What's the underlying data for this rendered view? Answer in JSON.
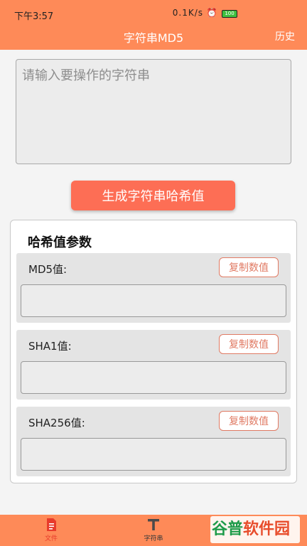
{
  "status_bar": {
    "time": "下午3:57",
    "speed": "0.1K/s",
    "battery": "100"
  },
  "header": {
    "title": "字符串MD5",
    "history_label": "历史"
  },
  "input": {
    "placeholder": "请输入要操作的字符串",
    "value": ""
  },
  "generate_button": "生成字符串哈希值",
  "hash_panel": {
    "title": "哈希值参数",
    "items": [
      {
        "label": "MD5值:",
        "copy_label": "复制数值",
        "value": ""
      },
      {
        "label": "SHA1值:",
        "copy_label": "复制数值",
        "value": ""
      },
      {
        "label": "SHA256值:",
        "copy_label": "复制数值",
        "value": ""
      }
    ]
  },
  "bottom_nav": {
    "tabs": [
      {
        "label": "文件",
        "icon": "file-icon",
        "active": true
      },
      {
        "label": "字符串",
        "icon": "text-icon",
        "active": false
      }
    ]
  },
  "watermark": {
    "part1": "谷普",
    "part2": "软件园"
  },
  "colors": {
    "accent": "#fe8a58",
    "button": "#fd6e55",
    "copy_border": "#e07a63"
  }
}
